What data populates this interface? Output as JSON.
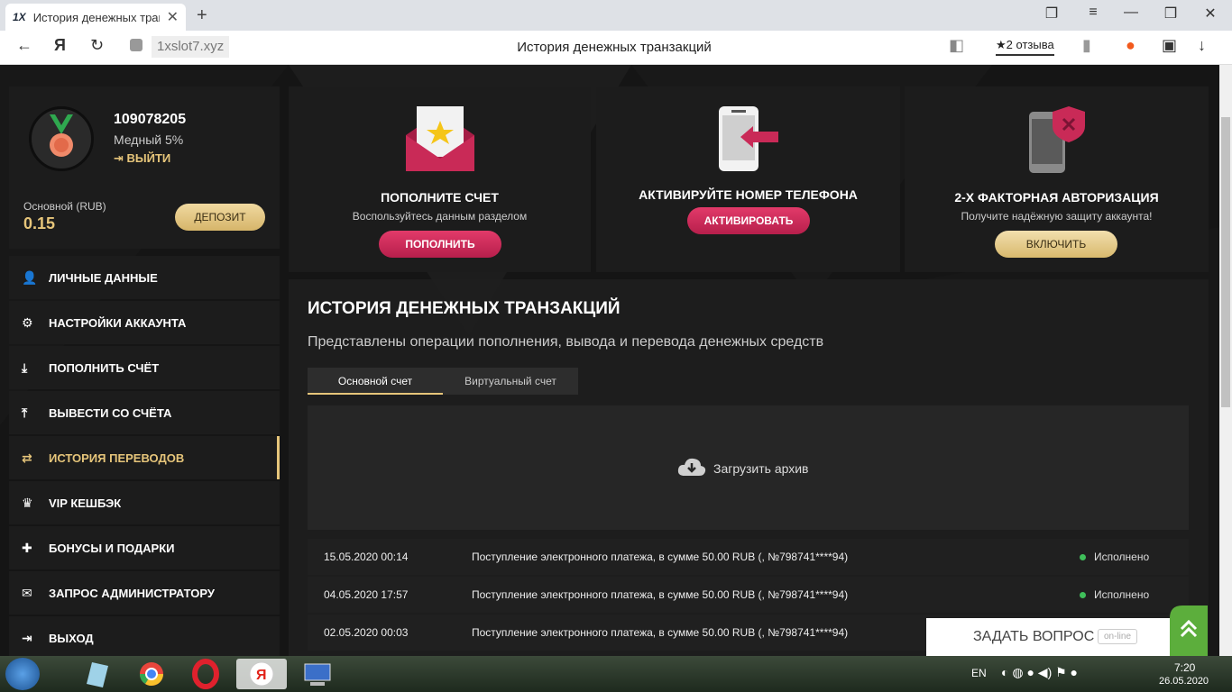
{
  "browser": {
    "tab_title": "История денежных транзакций",
    "tab_favicon": "1X",
    "domain": "1xslot7.xyz",
    "page_title": "История денежных транзакций",
    "reviews_label": "★2 отзыва"
  },
  "profile": {
    "user_id": "109078205",
    "level": "Медный 5%",
    "logout_label": "ВЫЙТИ",
    "balance_label": "Основной (RUB)",
    "balance_value": "0.15",
    "deposit_label": "ДЕПОЗИТ"
  },
  "menu": {
    "items": [
      {
        "label": "ЛИЧНЫЕ ДАННЫЕ",
        "icon": "user-add-icon"
      },
      {
        "label": "НАСТРОЙКИ АККАУНТА",
        "icon": "gears-icon"
      },
      {
        "label": "ПОПОЛНИТЬ СЧЁТ",
        "icon": "download-icon"
      },
      {
        "label": "ВЫВЕСТИ СО СЧЁТА",
        "icon": "upload-icon"
      },
      {
        "label": "ИСТОРИЯ ПЕРЕВОДОВ",
        "icon": "transfer-arrows-icon"
      },
      {
        "label": "VIP КЕШБЭК",
        "icon": "crown-icon"
      },
      {
        "label": "БОНУСЫ И ПОДАРКИ",
        "icon": "gift-icon"
      },
      {
        "label": "ЗАПРОС АДМИНИСТРАТОРУ",
        "icon": "envelope-icon"
      },
      {
        "label": "ВЫХОД",
        "icon": "logout-icon"
      }
    ],
    "active_index": 4
  },
  "cards": {
    "deposit": {
      "title": "ПОПОЛНИТЕ СЧЕТ",
      "subtitle": "Воспользуйтесь данным разделом",
      "button": "ПОПОЛНИТЬ"
    },
    "phone": {
      "title": "АКТИВИРУЙТЕ НОМЕР ТЕЛЕФОНА",
      "button": "АКТИВИРОВАТЬ"
    },
    "twofa": {
      "title": "2-Х ФАКТОРНАЯ АВТОРИЗАЦИЯ",
      "subtitle": "Получите надёжную защиту аккаунта!",
      "button": "ВКЛЮЧИТЬ"
    }
  },
  "history": {
    "title": "ИСТОРИЯ ДЕНЕЖНЫХ ТРАНЗАКЦИЙ",
    "subtitle": "Представлены операции пополнения, вывода и перевода денежных средств",
    "tabs": [
      "Основной счет",
      "Виртуальный счет"
    ],
    "archive_label": "Загрузить архив",
    "transactions": [
      {
        "date": "15.05.2020 00:14",
        "description": "Поступление электронного платежа, в сумме 50.00 RUB (, №798741****94)",
        "status": "Исполнено"
      },
      {
        "date": "04.05.2020 17:57",
        "description": "Поступление электронного платежа, в сумме 50.00 RUB (, №798741****94)",
        "status": "Исполнено"
      },
      {
        "date": "02.05.2020 00:03",
        "description": "Поступление электронного платежа, в сумме 50.00 RUB (, №798741****94)",
        "status": ""
      }
    ]
  },
  "chat": {
    "label": "ЗАДАТЬ ВОПРОС",
    "status": "on-line"
  },
  "taskbar": {
    "lang": "EN",
    "time": "7:20",
    "date": "26.05.2020"
  },
  "colors": {
    "accent_gold": "#e6c57a",
    "accent_red": "#c92a57",
    "status_green": "#3fbf5a"
  }
}
